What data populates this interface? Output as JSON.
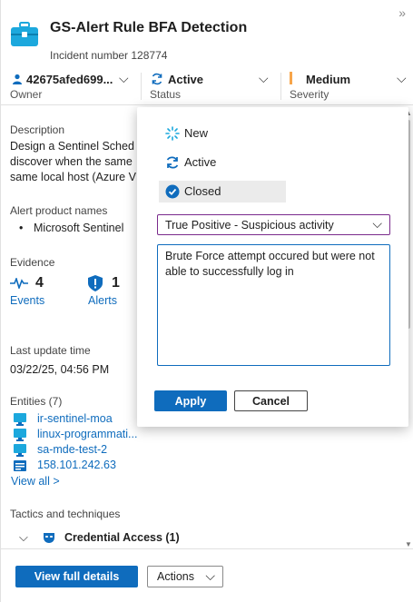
{
  "header": {
    "title": "GS-Alert Rule BFA Detection",
    "incident_number": "Incident number 128774"
  },
  "meta": {
    "owner": {
      "value": "42675afed699...",
      "label": "Owner"
    },
    "status": {
      "value": "Active",
      "label": "Status"
    },
    "severity": {
      "value": "Medium",
      "label": "Severity"
    }
  },
  "description": {
    "label": "Description",
    "lines": [
      "Design a Sentinel Sched",
      "discover when the same",
      "same local host (Azure V"
    ]
  },
  "alert_products": {
    "label": "Alert product names",
    "items": [
      "Microsoft Sentinel"
    ]
  },
  "evidence": {
    "label": "Evidence",
    "events": {
      "count": "4",
      "label": "Events"
    },
    "alerts": {
      "count": "1",
      "label": "Alerts"
    }
  },
  "last_update": {
    "label": "Last update time",
    "value": "03/22/25, 04:56 PM"
  },
  "entities": {
    "label": "Entities (7)",
    "items": [
      {
        "name": "ir-sentinel-moa",
        "icon": "computer-icon"
      },
      {
        "name": "linux-programmati...",
        "icon": "computer-icon"
      },
      {
        "name": "sa-mde-test-2",
        "icon": "computer-icon"
      },
      {
        "name": "158.101.242.63",
        "icon": "ip-address-icon"
      }
    ],
    "view_all": "View all >"
  },
  "tactics": {
    "label": "Tactics and techniques",
    "item": "Credential Access (1)"
  },
  "footer": {
    "view_details": "View full details",
    "actions": "Actions"
  },
  "status_popup": {
    "options": [
      {
        "label": "New",
        "icon": "new-icon"
      },
      {
        "label": "Active",
        "icon": "active-sync-icon"
      },
      {
        "label": "Closed",
        "icon": "closed-check-icon"
      }
    ],
    "selected": "Closed",
    "classification": "True Positive - Suspicious activity",
    "comment": "Brute Force attempt occured but were not able to successfully log in",
    "apply": "Apply",
    "cancel": "Cancel"
  },
  "colors": {
    "accent": "#0f6cbd",
    "severity_medium": "#f7a54a",
    "select_border": "#7a2a8c",
    "briefcase": "#1ca8dd"
  }
}
